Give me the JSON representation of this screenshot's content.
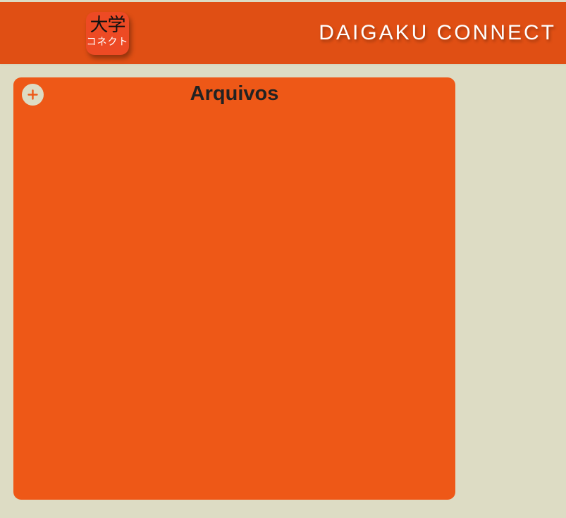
{
  "header": {
    "logo": {
      "kanji": "大学",
      "kana": "コネクト"
    },
    "brand_title": "DAIGAKU CONNECT"
  },
  "files_panel": {
    "title": "Arquivos",
    "add_button_icon": "plus-icon"
  },
  "colors": {
    "header_bg": "#e04f14",
    "panel_bg": "#ee5817",
    "page_bg": "#dddcc4",
    "logo_bg": "#ed4a24",
    "title_text": "#222222"
  }
}
